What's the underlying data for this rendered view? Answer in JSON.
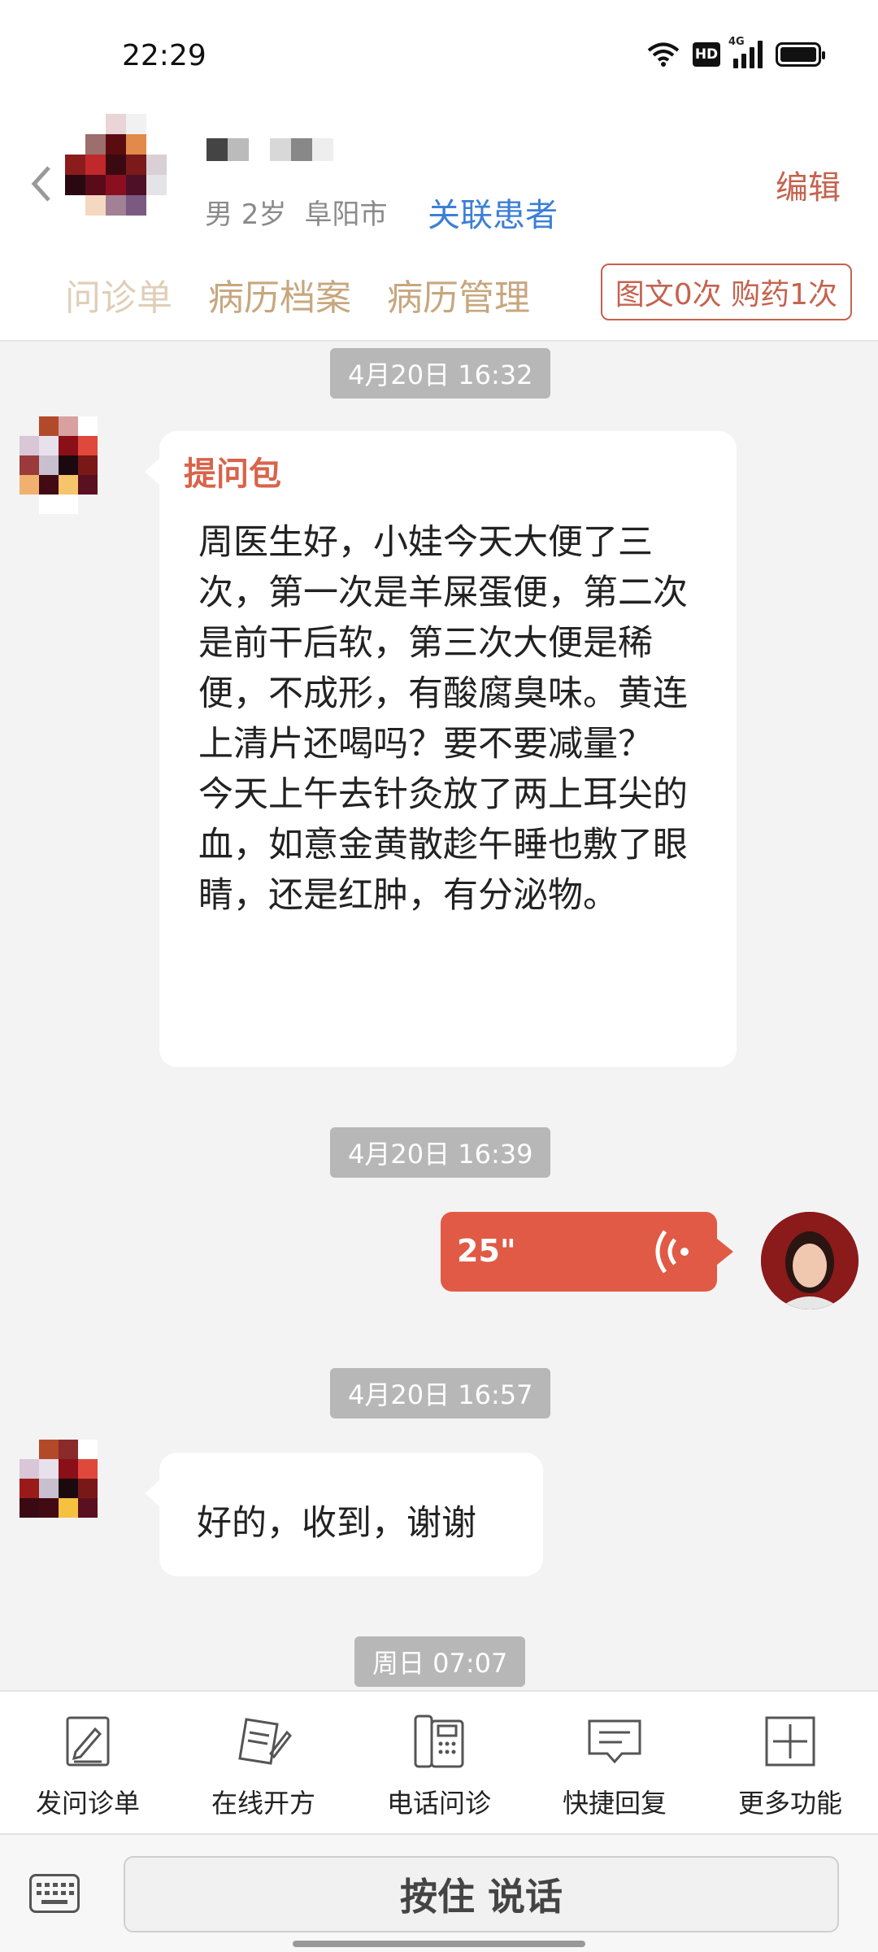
{
  "status_bar": {
    "time": "22:29",
    "hd_label": "HD",
    "network": "4G"
  },
  "header": {
    "gender_age": "男 2岁",
    "city": "阜阳市",
    "link_patient": "关联患者",
    "edit": "编辑",
    "tabs": [
      "问诊单",
      "病历档案",
      "病历管理"
    ],
    "usage": "图文0次 购药1次"
  },
  "chat": {
    "messages": [
      {
        "time": "4月20日 16:32",
        "type": "ask-package",
        "title": "提问包",
        "text": "周医生好，小娃今天大便了三次，第一次是羊屎蛋便，第二次是前干后软，第三次大便是稀便，不成形，有酸腐臭味。黄连上清片还喝吗？要不要减量？\n今天上午去针灸放了两上耳尖的血，如意金黄散趁午睡也敷了眼睛，还是红肿，有分泌物。"
      },
      {
        "time": "4月20日 16:39",
        "type": "voice",
        "duration": "25\""
      },
      {
        "time": "4月20日 16:57",
        "type": "text",
        "text": "好的，收到，谢谢"
      },
      {
        "time": "周日 07:07"
      }
    ]
  },
  "toolbar": {
    "items": [
      {
        "label": "发问诊单",
        "icon": "form-icon"
      },
      {
        "label": "在线开方",
        "icon": "prescription-icon"
      },
      {
        "label": "电话问诊",
        "icon": "phone-icon"
      },
      {
        "label": "快捷回复",
        "icon": "quick-reply-icon"
      },
      {
        "label": "更多功能",
        "icon": "plus-icon"
      }
    ]
  },
  "input": {
    "talk_label": "按住 说话"
  },
  "colors": {
    "accent": "#e05a45",
    "brand_gold": "#c7a77f",
    "link_blue": "#3d7fd6"
  }
}
